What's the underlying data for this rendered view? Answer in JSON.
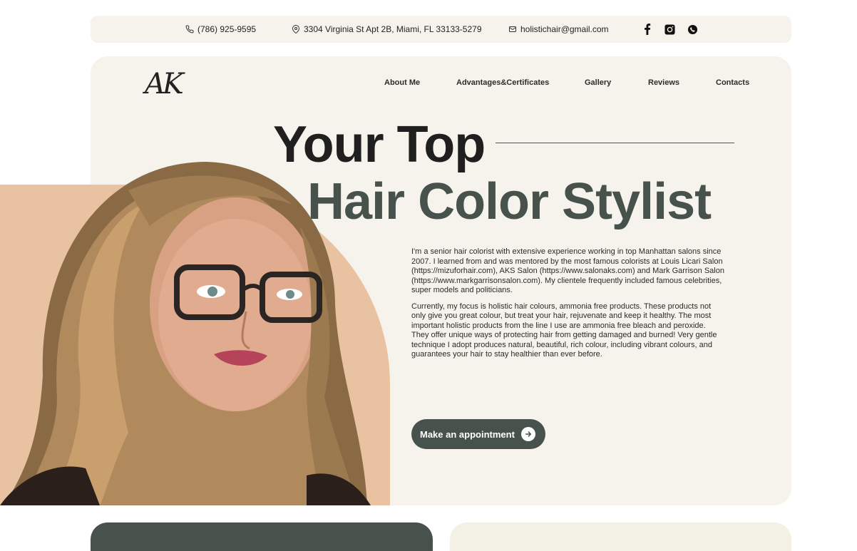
{
  "topbar": {
    "phone": "(786) 925-9595",
    "address": "3304 Virginia St Apt 2B, Miami, FL 33133-5279",
    "email": "holistichair@gmail.com",
    "socials": [
      "facebook-icon",
      "instagram-icon",
      "whatsapp-icon"
    ]
  },
  "logo": "AK",
  "nav": [
    "About Me",
    "Advantages&Certificates",
    "Gallery",
    "Reviews",
    "Contacts"
  ],
  "hero": {
    "title_line1": "Your Top",
    "title_line2": "Hair Color Stylist",
    "paragraph1": "I'm a senior hair colorist with extensive experience working in top Manhattan salons since 2007. I learned from and was mentored by the most famous colorists at Louis Licari Salon (https://mizuforhair.com), AKS Salon (https://www.salonaks.com) and Mark Garrison Salon (https://www.markgarrisonsalon.com). My clientele frequently included famous celebrities, super models and politicians.",
    "paragraph2": "Currently, my focus is holistic hair colours, ammonia free products. These products not only give you great colour, but treat your hair, rejuvenate and keep it healthy. The most important holistic products from the line I use are ammonia free bleach and peroxide. They offer unique ways of protecting hair from getting damaged and burned! Very gentle technique I adopt produces natural, beautiful, rich colour, including vibrant colours, and guarantees your hair to stay healthier than ever before.",
    "cta": "Make an appointment"
  },
  "colors": {
    "accent": "#47524c",
    "cream": "#f6f3ec",
    "peach": "#e8c2a1"
  }
}
